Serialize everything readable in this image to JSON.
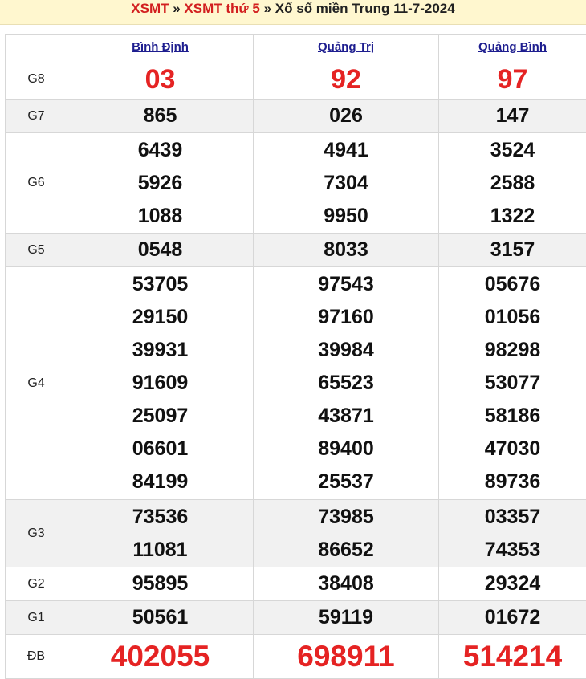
{
  "header": {
    "link1": "XSMT",
    "sep1": " » ",
    "link2": "XSMT thứ 5",
    "sep2": " » ",
    "title": "Xổ số miền Trung 11-7-2024"
  },
  "provinces": [
    "Bình Định",
    "Quảng Trị",
    "Quảng Bình"
  ],
  "prizes": {
    "G8": {
      "label": "G8",
      "values": [
        [
          "03"
        ],
        [
          "92"
        ],
        [
          "97"
        ]
      ]
    },
    "G7": {
      "label": "G7",
      "values": [
        [
          "865"
        ],
        [
          "026"
        ],
        [
          "147"
        ]
      ]
    },
    "G6": {
      "label": "G6",
      "values": [
        [
          "6439",
          "5926",
          "1088"
        ],
        [
          "4941",
          "7304",
          "9950"
        ],
        [
          "3524",
          "2588",
          "1322"
        ]
      ]
    },
    "G5": {
      "label": "G5",
      "values": [
        [
          "0548"
        ],
        [
          "8033"
        ],
        [
          "3157"
        ]
      ]
    },
    "G4": {
      "label": "G4",
      "values": [
        [
          "53705",
          "29150",
          "39931",
          "91609",
          "25097",
          "06601",
          "84199"
        ],
        [
          "97543",
          "97160",
          "39984",
          "65523",
          "43871",
          "89400",
          "25537"
        ],
        [
          "05676",
          "01056",
          "98298",
          "53077",
          "58186",
          "47030",
          "89736"
        ]
      ]
    },
    "G3": {
      "label": "G3",
      "values": [
        [
          "73536",
          "11081"
        ],
        [
          "73985",
          "86652"
        ],
        [
          "03357",
          "74353"
        ]
      ]
    },
    "G2": {
      "label": "G2",
      "values": [
        [
          "95895"
        ],
        [
          "38408"
        ],
        [
          "29324"
        ]
      ]
    },
    "G1": {
      "label": "G1",
      "values": [
        [
          "50561"
        ],
        [
          "59119"
        ],
        [
          "01672"
        ]
      ]
    },
    "DB": {
      "label": "ĐB",
      "values": [
        [
          "402055"
        ],
        [
          "698911"
        ],
        [
          "514214"
        ]
      ]
    }
  },
  "colors": {
    "accent_red": "#e52323",
    "header_bg": "#fff7cf",
    "link_blue": "#1d1d8f",
    "row_shade": "#f1f1f1"
  }
}
